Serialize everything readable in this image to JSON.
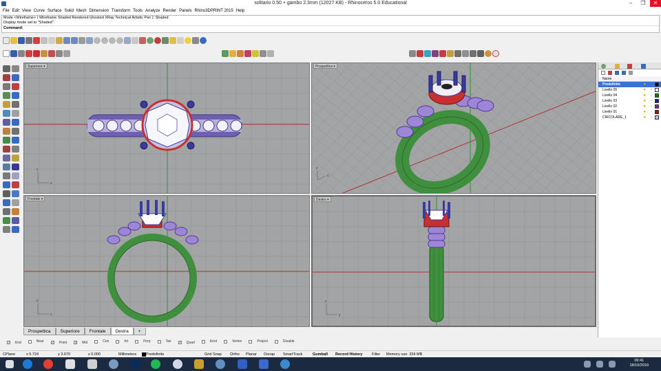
{
  "window": {
    "title": "solitario 0.50 + gambo 2.3mm (12027 KB) - Rhinoceros 5.0 Educational",
    "minimize": "–",
    "maximize": "❐",
    "close": "✕"
  },
  "menu": [
    "File",
    "Edit",
    "View",
    "Curve",
    "Surface",
    "Solid",
    "Mesh",
    "Dimension",
    "Transform",
    "Tools",
    "Analyze",
    "Render",
    "Panels",
    "Rhino3DPRINT 2015",
    "Help"
  ],
  "command_history": [
    "Mode <Wireframe> ( Wireframe  Shaded  Rendered  Ghosted  XRay  Technical  Artistic  Pen ): Shaded",
    "Display mode set to \"Shaded\"."
  ],
  "command_prompt": "Command:",
  "viewports": {
    "top": {
      "label": "Superiore",
      "menu_icon": "▾"
    },
    "perspective": {
      "label": "Prospettica",
      "menu_icon": "▾"
    },
    "front": {
      "label": "Frontale",
      "menu_icon": "▾"
    },
    "right": {
      "label": "Destra",
      "menu_icon": "▾"
    },
    "axis_x": "x",
    "axis_y": "y",
    "axis_z": "z"
  },
  "viewport_tabs": [
    "Prospettica",
    "Superiore",
    "Frontale",
    "Destra"
  ],
  "active_viewport_tab": "Destra",
  "add_tab": "+",
  "osnap": [
    {
      "label": "End",
      "checked": true
    },
    {
      "label": "Near",
      "checked": false
    },
    {
      "label": "Point",
      "checked": true
    },
    {
      "label": "Mid",
      "checked": true
    },
    {
      "label": "Cen",
      "checked": false
    },
    {
      "label": "Int",
      "checked": false
    },
    {
      "label": "Perp",
      "checked": false
    },
    {
      "label": "Tan",
      "checked": false
    },
    {
      "label": "Quad",
      "checked": true
    },
    {
      "label": "Knot",
      "checked": false
    },
    {
      "label": "Vertex",
      "checked": false
    },
    {
      "label": "Project",
      "checked": false
    },
    {
      "label": "Disable",
      "checked": false
    }
  ],
  "status": {
    "cplane": "CPlane",
    "x": "x 5.724",
    "y": "y 3.670",
    "z": "z 0.000",
    "units": "Millimeters",
    "layer": "Predefinito",
    "grid_snap": "Grid Snap",
    "ortho": "Ortho",
    "planar": "Planar",
    "osnap": "Osnap",
    "smarttrack": "SmartTrack",
    "gumball": "Gumball",
    "record_history": "Record History",
    "filter": "Filter",
    "memory": "Memory use: 334 MB"
  },
  "layers": {
    "header": "Name",
    "rows": [
      {
        "name": "Predefinito",
        "color": "#000000",
        "selected": true
      },
      {
        "name": "Livello 05",
        "color": "#ffffff",
        "selected": false
      },
      {
        "name": "Livello 04",
        "color": "#1a7a1a",
        "selected": false
      },
      {
        "name": "Livello 03",
        "color": "#1a1aa0",
        "selected": false
      },
      {
        "name": "Livello 02",
        "color": "#7a2aa0",
        "selected": false
      },
      {
        "name": "Livello 01",
        "color": "#b01010",
        "selected": false
      },
      {
        "name": "CIRCOLARE_1",
        "color": "#c0c0e0",
        "selected": false
      }
    ]
  },
  "taskbar": {
    "time": "09:41",
    "date": "18/10/2019"
  },
  "colors": {
    "viewport_bg": "#a3a4a6",
    "grid": "#8f9092",
    "axis_x": "#b03030",
    "axis_y": "#2f8f2f",
    "shank": "#3f8f3f",
    "gem": "#7a50c8",
    "prong": "#3a3aa0",
    "setting": "#c83030"
  }
}
